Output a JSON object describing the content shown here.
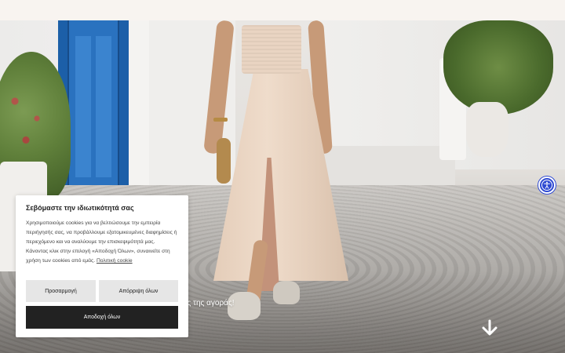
{
  "header": {
    "background": "#f8f4f0"
  },
  "hero": {
    "tagline_partial": "ιμές της αγοράς!",
    "scroll_icon": "arrow-down-icon",
    "accessibility_icon": "accessibility-icon",
    "accessibility_color": "#2e49d2"
  },
  "cookie_banner": {
    "title": "Σεβόμαστε την ιδιωτικότητά σας",
    "body": "Χρησιμοποιούμε cookies για να βελτιώσουμε την εμπειρία περιήγησής σας, να προβάλλουμε εξατομικευμένες διαφημίσεις ή περιεχόμενο και να αναλύουμε την επισκεψιμότητά μας. Κάνοντας κλικ στην επιλογή «Αποδοχή Όλων», συναινείτε στη χρήση των cookies από εμάς.",
    "policy_link": "Πολιτική cookie",
    "customize_label": "Προσαρμογή",
    "reject_label": "Απόρριψη όλων",
    "accept_label": "Αποδοχή όλων",
    "accept_bg": "#222222",
    "secondary_bg": "#e6e6e6"
  }
}
